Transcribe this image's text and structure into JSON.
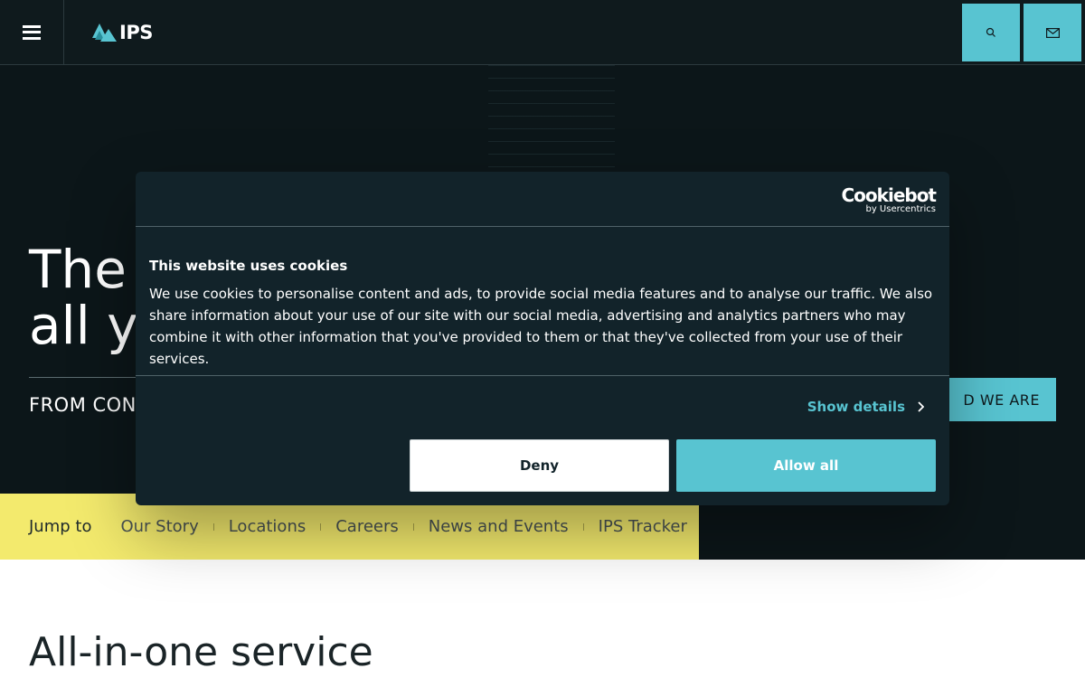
{
  "header": {
    "logo_text": "IPS",
    "menu_icon": "hamburger-icon",
    "search_icon": "search-icon",
    "mail_icon": "mail-icon"
  },
  "hero": {
    "title_line1": "The",
    "title_line2": "all y",
    "subtitle": "FROM CON",
    "cta": "D WE ARE"
  },
  "jump_bar": {
    "label": "Jump to",
    "links": [
      "Our Story",
      "Locations",
      "Careers",
      "News and Events",
      "IPS Tracker"
    ]
  },
  "content": {
    "section_title": "All-in-one service"
  },
  "cookie_dialog": {
    "brand": "Cookiebot",
    "brand_sub": "by Usercentrics",
    "title": "This website uses cookies",
    "body": "We use cookies to personalise content and ads, to provide social media features and to analyse our traffic. We also share information about your use of our site with our social media, advertising and analytics partners who may combine it with other information that you've provided to them or that they've collected from your use of their services.",
    "show_details": "Show details",
    "deny": "Deny",
    "allow_all": "Allow all"
  },
  "colors": {
    "accent": "#58c4d1",
    "header_bg": "#0f1a1d",
    "jump_bar_bg": "#f3ea6d",
    "dialog_bg": "#12232a"
  }
}
